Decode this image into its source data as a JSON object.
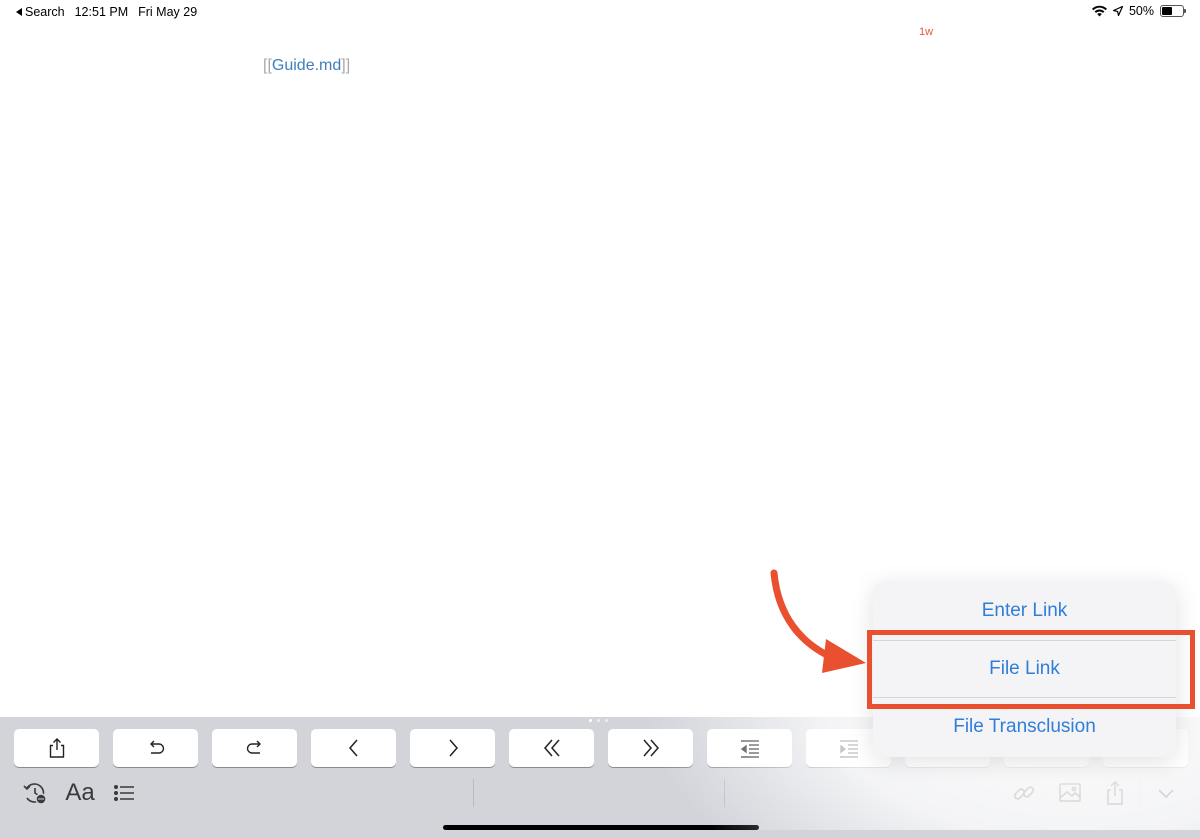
{
  "status_bar": {
    "back_label": "Search",
    "time": "12:51 PM",
    "date": "Fri May 29",
    "battery_text": "50%",
    "battery_level": 0.5
  },
  "editor": {
    "word_count": "1w",
    "link_open": "[[",
    "link_text": "Guide.md",
    "link_close": "]]"
  },
  "keyboard_row": [
    {
      "name": "share-key",
      "icon": "share-icon"
    },
    {
      "name": "undo-key",
      "icon": "undo-icon"
    },
    {
      "name": "redo-key",
      "icon": "redo-icon"
    },
    {
      "name": "cursor-left-key",
      "icon": "chevron-left-icon"
    },
    {
      "name": "cursor-right-key",
      "icon": "chevron-right-icon"
    },
    {
      "name": "word-left-key",
      "icon": "double-chevron-left-icon"
    },
    {
      "name": "word-right-key",
      "icon": "double-chevron-right-icon"
    },
    {
      "name": "outdent-key",
      "icon": "outdent-icon"
    },
    {
      "name": "indent-key",
      "icon": "indent-icon"
    }
  ],
  "bottom_bar": {
    "font_label": "Aa",
    "icons": [
      "history-icon",
      "list-icon",
      "link-icon",
      "image-icon",
      "share-icon",
      "chevron-down-icon"
    ]
  },
  "popover": {
    "items": [
      {
        "label": "Enter Link"
      },
      {
        "label": "File Link"
      },
      {
        "label": "File Transclusion"
      }
    ]
  },
  "colors": {
    "accent": "#2f7ed8",
    "highlight": "#e8502f",
    "link": "#3f7fb8",
    "toolbar_bg": "#d2d4da"
  }
}
